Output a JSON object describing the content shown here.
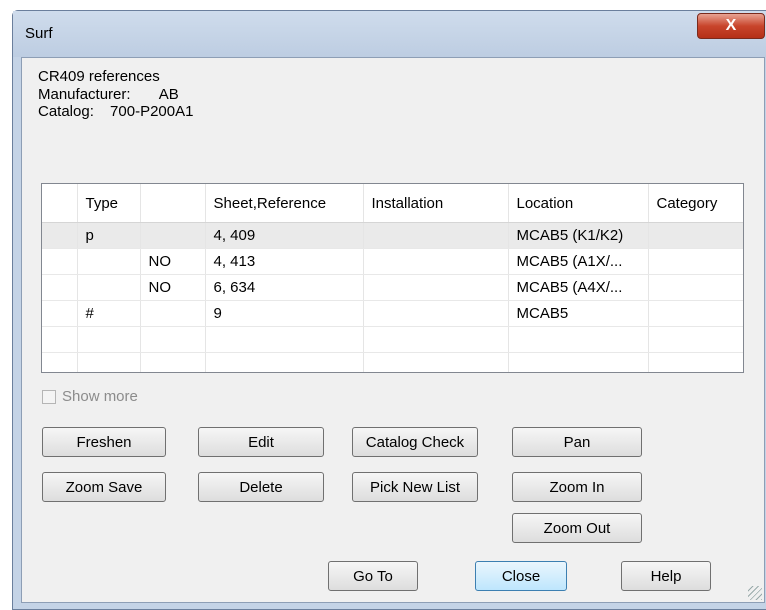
{
  "window": {
    "title": "Surf",
    "close_glyph": "X"
  },
  "info": {
    "heading": "CR409 references",
    "manufacturer_label": "Manufacturer:",
    "manufacturer_value": "AB",
    "catalog_label": "Catalog:",
    "catalog_value": "700-P200A1"
  },
  "table": {
    "columns": [
      "",
      "Type",
      "",
      "Sheet,Reference",
      "Installation",
      "Location",
      "Category"
    ],
    "rows": [
      [
        "",
        "p",
        "",
        "4, 409",
        "",
        "MCAB5 (K1/K2)",
        ""
      ],
      [
        "",
        "",
        "NO",
        "4, 413",
        "",
        "MCAB5 (A1X/...",
        ""
      ],
      [
        "",
        "",
        "NO",
        "6, 634",
        "",
        "MCAB5 (A4X/...",
        ""
      ],
      [
        "",
        "#",
        "",
        "9",
        "",
        "MCAB5",
        ""
      ],
      [
        "",
        "",
        "",
        "",
        "",
        "",
        ""
      ],
      [
        "",
        "",
        "",
        "",
        "",
        "",
        ""
      ]
    ]
  },
  "show_more": {
    "label": "Show more",
    "checked": false,
    "enabled": false
  },
  "buttons": {
    "freshen": "Freshen",
    "edit": "Edit",
    "catalog_check": "Catalog Check",
    "pan": "Pan",
    "zoom_save": "Zoom Save",
    "delete": "Delete",
    "pick_new_list": "Pick New List",
    "zoom_in": "Zoom In",
    "zoom_out": "Zoom Out",
    "go_to": "Go To",
    "close": "Close",
    "help": "Help"
  },
  "side_mark": "<",
  "colors": {
    "frame": "#c4d3e6",
    "close_button": "#c8452c",
    "client_bg": "#f0f0f0"
  }
}
